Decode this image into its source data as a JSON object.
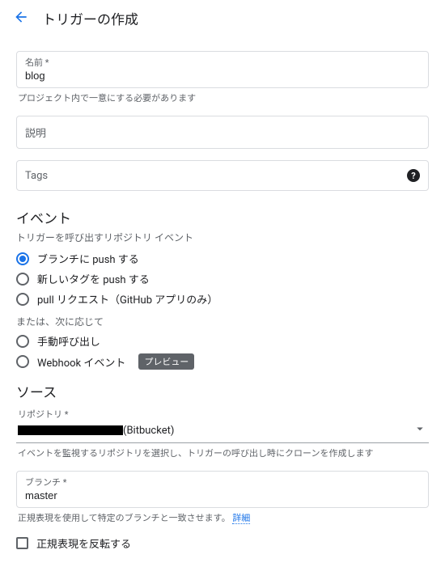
{
  "header": {
    "title": "トリガーの作成"
  },
  "name_field": {
    "label": "名前 *",
    "value": "blog",
    "hint": "プロジェクト内で一意にする必要があります"
  },
  "desc_field": {
    "placeholder": "説明"
  },
  "tags_field": {
    "placeholder": "Tags"
  },
  "event": {
    "title": "イベント",
    "subtitle": "トリガーを呼び出すリポジトリ イベント",
    "options": [
      "ブランチに push する",
      "新しいタグを push する",
      "pull リクエスト（GitHub アプリのみ）"
    ],
    "or_label": "または、次に応じて",
    "alt_options": [
      "手動呼び出し",
      "Webhook イベント"
    ],
    "preview_chip": "プレビュー"
  },
  "source": {
    "title": "ソース",
    "repo_label": "リポジトリ *",
    "repo_suffix": "(Bitbucket)",
    "repo_hint": "イベントを監視するリポジトリを選択し、トリガーの呼び出し時にクローンを作成します",
    "branch_label": "ブランチ *",
    "branch_value": "master",
    "branch_hint_text": "正規表現を使用して特定のブランチと一致させます。",
    "branch_hint_link": "詳細",
    "invert_label": "正規表現を反転する"
  }
}
